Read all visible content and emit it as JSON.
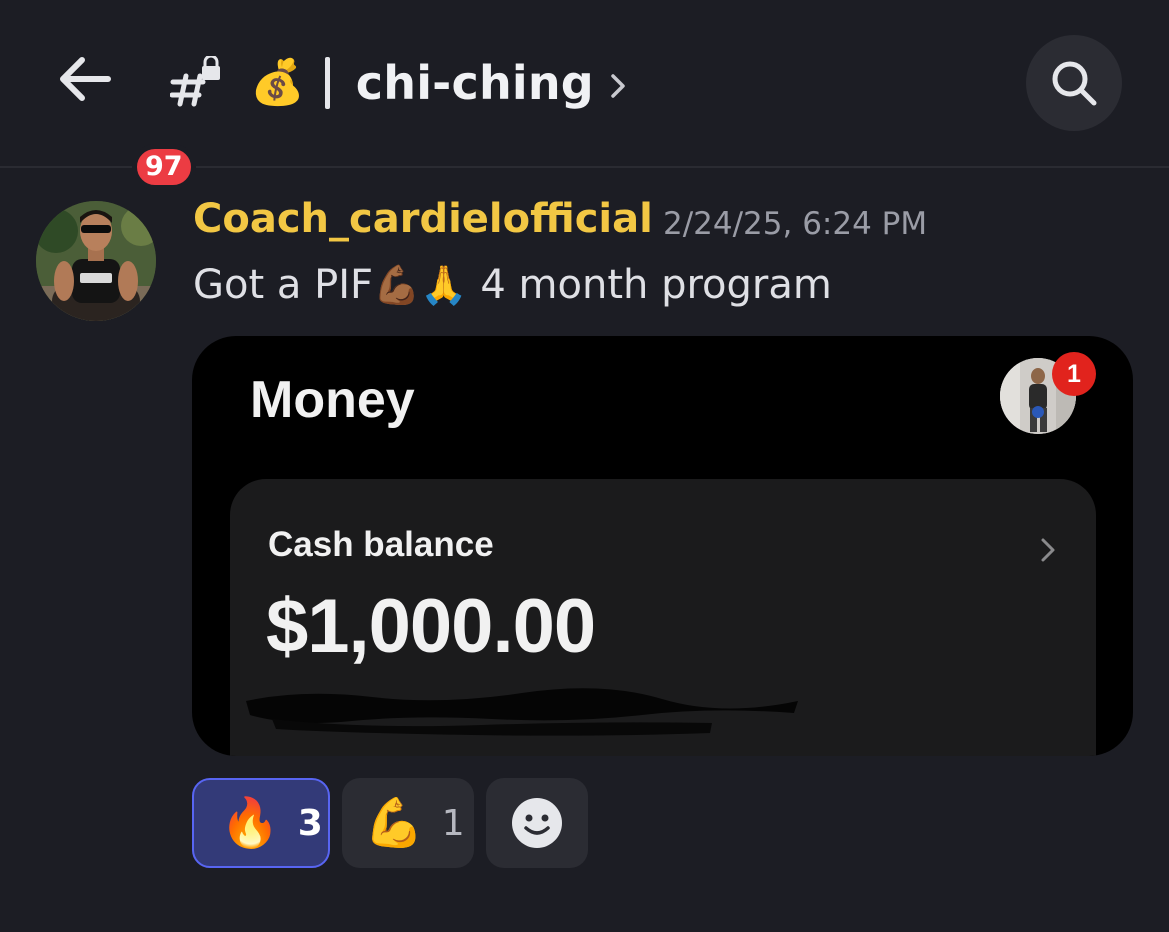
{
  "header": {
    "unread_badge": "97",
    "channel_emoji": "💰",
    "channel_name": "chi-ching",
    "chevron": "›"
  },
  "message": {
    "author": "Coach_cardielofficial",
    "author_color": "#f2c744",
    "timestamp": "2/24/25, 6:24 PM",
    "text_before": "Got a PIF",
    "text_emojis": "💪🏾🙏",
    "text_after": " 4 month program"
  },
  "attachment": {
    "title": "Money",
    "notification_count": "1",
    "card": {
      "label": "Cash balance",
      "amount": "$1,000.00"
    }
  },
  "reactions": [
    {
      "emoji": "🔥",
      "count": "3",
      "active": true
    },
    {
      "emoji": "💪",
      "count": "1",
      "active": false
    }
  ],
  "icons": {
    "back": "back-arrow-icon",
    "channel": "locked-channel-icon",
    "search": "search-icon",
    "add_reaction": "add-reaction-icon"
  },
  "colors": {
    "background": "#1c1d24",
    "badge": "#ec3c43",
    "active_reaction": "#333a78",
    "active_reaction_border": "#5865f2"
  }
}
